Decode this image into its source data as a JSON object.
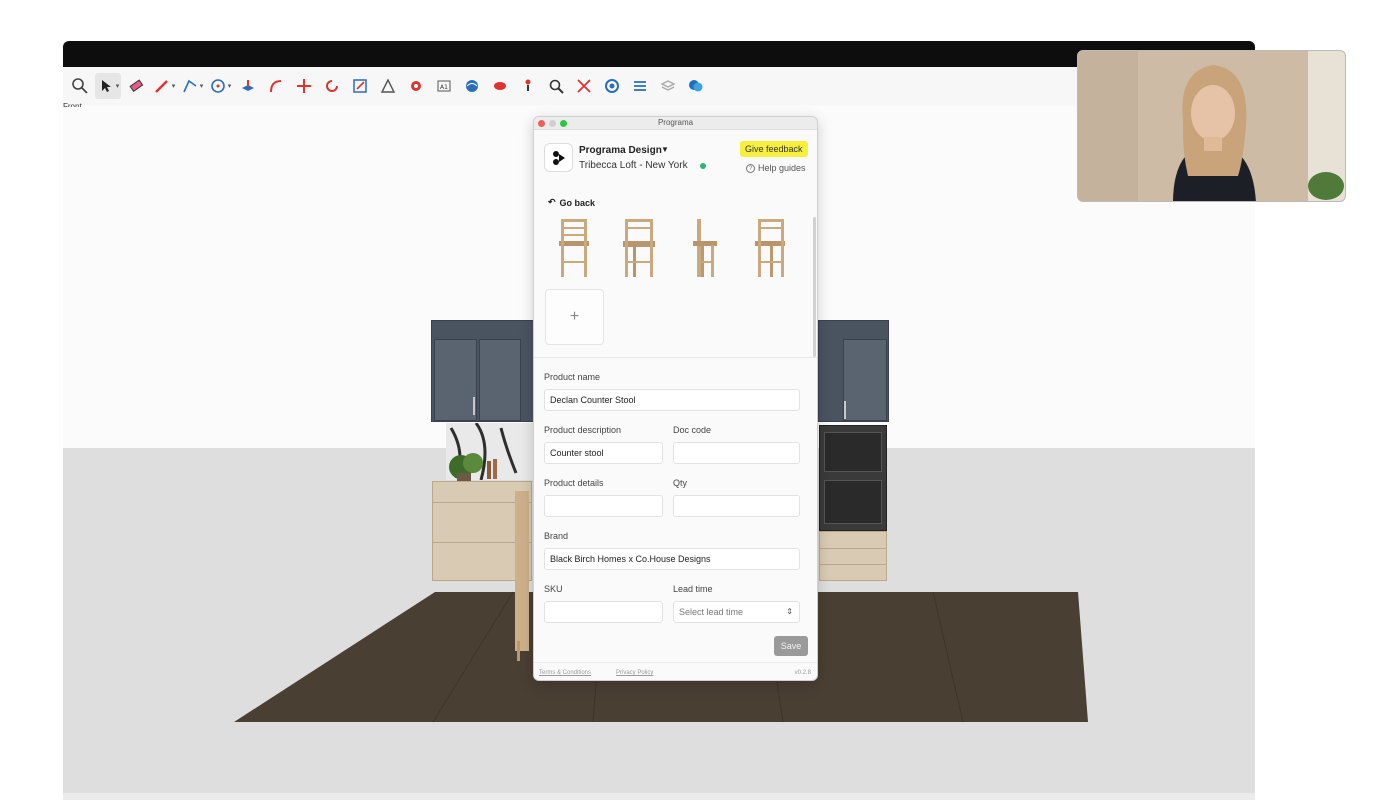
{
  "host": {
    "view_label": "Front"
  },
  "panel": {
    "window_title": "Programa",
    "org_name": "Programa Design",
    "project_name": "Tribecca Loft - New York",
    "feedback_label": "Give feedback",
    "help_label": "Help guides",
    "go_back_label": "Go back",
    "add_image_label": "+",
    "fields": {
      "product_name": {
        "label": "Product name",
        "value": "Declan Counter Stool"
      },
      "product_description": {
        "label": "Product description",
        "value": "Counter stool"
      },
      "doc_code": {
        "label": "Doc code",
        "value": ""
      },
      "product_details": {
        "label": "Product details",
        "value": ""
      },
      "qty": {
        "label": "Qty",
        "value": ""
      },
      "brand": {
        "label": "Brand",
        "value": "Black Birch Homes x Co.House Designs"
      },
      "sku": {
        "label": "SKU",
        "value": ""
      },
      "lead_time": {
        "label": "Lead time",
        "placeholder": "Select lead time"
      }
    },
    "save_label": "Save",
    "footer": {
      "terms": "Terms & Conditions",
      "privacy": "Privacy Policy",
      "version": "v0.2.8"
    }
  },
  "colors": {
    "feedback_bg": "#f6ef3e",
    "status_dot": "#2bb673",
    "save_bg": "#9a9a9a",
    "cabinet": "#4a5360",
    "floor": "#4a3f33"
  },
  "icons": {
    "toolbar": [
      "search-icon",
      "select-arrow-icon",
      "eraser-icon",
      "pencil-icon",
      "line-icon",
      "circle-icon",
      "push-pull-icon",
      "follow-me-icon",
      "move-icon",
      "rotate-icon",
      "scale-icon",
      "protractor-icon",
      "paint-icon",
      "text-icon",
      "orbit-icon",
      "pan-icon",
      "zoom-icon",
      "zoom-extents-icon",
      "section-icon",
      "styles-icon",
      "layers-icon",
      "extension-icon"
    ]
  }
}
